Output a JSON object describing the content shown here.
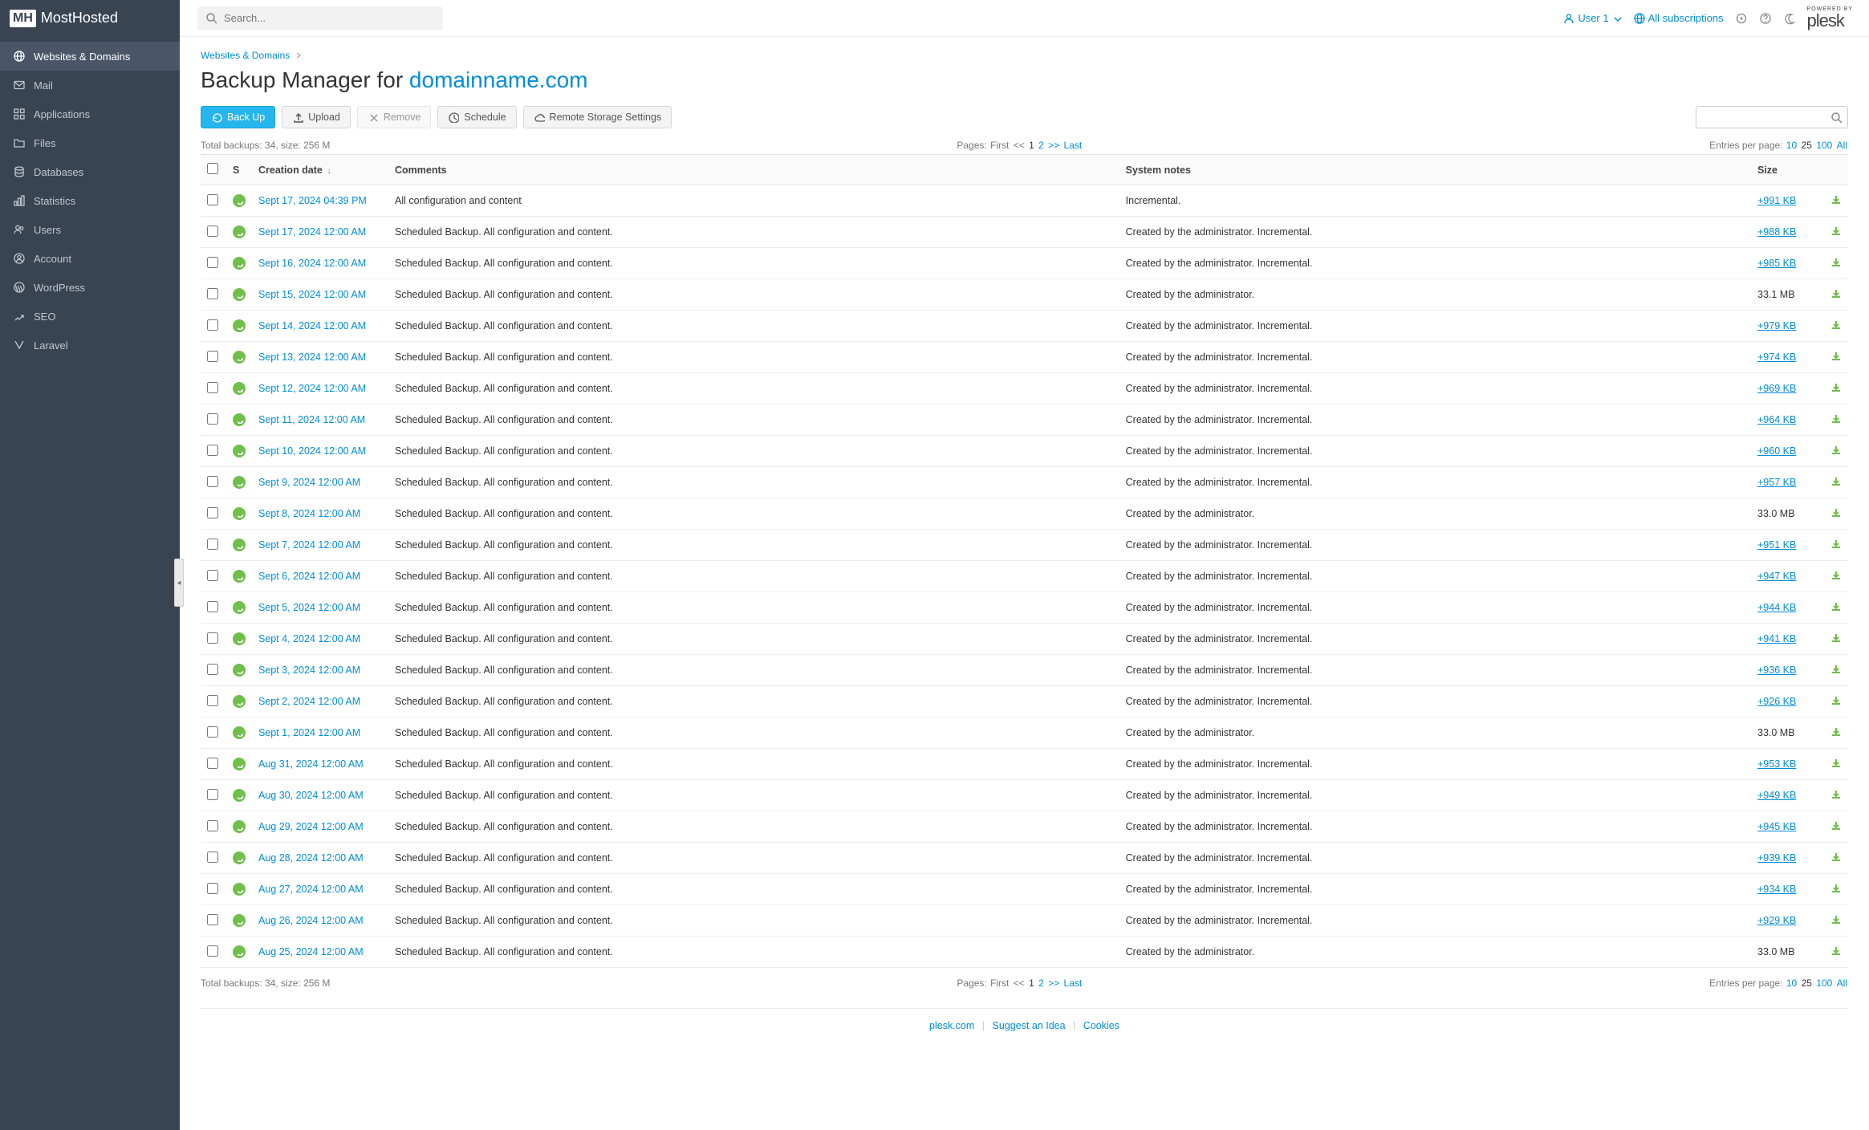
{
  "brand": {
    "badge": "MH",
    "name": "MostHosted"
  },
  "search": {
    "placeholder": "Search..."
  },
  "topbar": {
    "user_label": "User 1",
    "subs_label": "All subscriptions",
    "powered": "POWERED BY",
    "plesk": "plesk"
  },
  "sidebar": {
    "items": [
      {
        "label": "Websites & Domains",
        "icon": "globe",
        "active": true
      },
      {
        "label": "Mail",
        "icon": "mail"
      },
      {
        "label": "Applications",
        "icon": "grid"
      },
      {
        "label": "Files",
        "icon": "folder"
      },
      {
        "label": "Databases",
        "icon": "database"
      },
      {
        "label": "Statistics",
        "icon": "stats"
      },
      {
        "label": "Users",
        "icon": "users"
      },
      {
        "label": "Account",
        "icon": "account"
      },
      {
        "label": "WordPress",
        "icon": "wordpress"
      },
      {
        "label": "SEO",
        "icon": "seo"
      },
      {
        "label": "Laravel",
        "icon": "laravel"
      }
    ]
  },
  "breadcrumb": {
    "item": "Websites & Domains"
  },
  "page_title": {
    "prefix": "Backup Manager for ",
    "domain": "domainname.com"
  },
  "toolbar": {
    "backup": "Back Up",
    "upload": "Upload",
    "remove": "Remove",
    "schedule": "Schedule",
    "remote": "Remote Storage Settings"
  },
  "summary": {
    "total_backups_label": "Total backups: 34, size: 256 M"
  },
  "pagination": {
    "pages_label": "Pages:",
    "first": "First",
    "prev": "<<",
    "p1": "1",
    "p2": "2",
    "next": ">>",
    "last": "Last"
  },
  "entries_per_page": {
    "label": "Entries per page:",
    "o10": "10",
    "o25": "25",
    "o100": "100",
    "oall": "All"
  },
  "columns": {
    "status": "S",
    "creation": "Creation date",
    "sort": "↓",
    "comments": "Comments",
    "notes": "System notes",
    "size": "Size"
  },
  "rows": [
    {
      "date": "Sept 17, 2024 04:39 PM",
      "comments": "All configuration and content",
      "notes": "Incremental.",
      "size": "+991 KB",
      "size_link": true
    },
    {
      "date": "Sept 17, 2024 12:00 AM",
      "comments": "Scheduled Backup. All configuration and content.",
      "notes": "Created by the administrator. Incremental.",
      "size": "+988 KB",
      "size_link": true
    },
    {
      "date": "Sept 16, 2024 12:00 AM",
      "comments": "Scheduled Backup. All configuration and content.",
      "notes": "Created by the administrator. Incremental.",
      "size": "+985 KB",
      "size_link": true
    },
    {
      "date": "Sept 15, 2024 12:00 AM",
      "comments": "Scheduled Backup. All configuration and content.",
      "notes": "Created by the administrator.",
      "size": "33.1 MB",
      "size_link": false
    },
    {
      "date": "Sept 14, 2024 12:00 AM",
      "comments": "Scheduled Backup. All configuration and content.",
      "notes": "Created by the administrator. Incremental.",
      "size": "+979 KB",
      "size_link": true
    },
    {
      "date": "Sept 13, 2024 12:00 AM",
      "comments": "Scheduled Backup. All configuration and content.",
      "notes": "Created by the administrator. Incremental.",
      "size": "+974 KB",
      "size_link": true
    },
    {
      "date": "Sept 12, 2024 12:00 AM",
      "comments": "Scheduled Backup. All configuration and content.",
      "notes": "Created by the administrator. Incremental.",
      "size": "+969 KB",
      "size_link": true
    },
    {
      "date": "Sept 11, 2024 12:00 AM",
      "comments": "Scheduled Backup. All configuration and content.",
      "notes": "Created by the administrator. Incremental.",
      "size": "+964 KB",
      "size_link": true
    },
    {
      "date": "Sept 10, 2024 12:00 AM",
      "comments": "Scheduled Backup. All configuration and content.",
      "notes": "Created by the administrator. Incremental.",
      "size": "+960 KB",
      "size_link": true
    },
    {
      "date": "Sept 9, 2024 12:00 AM",
      "comments": "Scheduled Backup. All configuration and content.",
      "notes": "Created by the administrator. Incremental.",
      "size": "+957 KB",
      "size_link": true
    },
    {
      "date": "Sept 8, 2024 12:00 AM",
      "comments": "Scheduled Backup. All configuration and content.",
      "notes": "Created by the administrator.",
      "size": "33.0 MB",
      "size_link": false
    },
    {
      "date": "Sept 7, 2024 12:00 AM",
      "comments": "Scheduled Backup. All configuration and content.",
      "notes": "Created by the administrator. Incremental.",
      "size": "+951 KB",
      "size_link": true
    },
    {
      "date": "Sept 6, 2024 12:00 AM",
      "comments": "Scheduled Backup. All configuration and content.",
      "notes": "Created by the administrator. Incremental.",
      "size": "+947 KB",
      "size_link": true
    },
    {
      "date": "Sept 5, 2024 12:00 AM",
      "comments": "Scheduled Backup. All configuration and content.",
      "notes": "Created by the administrator. Incremental.",
      "size": "+944 KB",
      "size_link": true
    },
    {
      "date": "Sept 4, 2024 12:00 AM",
      "comments": "Scheduled Backup. All configuration and content.",
      "notes": "Created by the administrator. Incremental.",
      "size": "+941 KB",
      "size_link": true
    },
    {
      "date": "Sept 3, 2024 12:00 AM",
      "comments": "Scheduled Backup. All configuration and content.",
      "notes": "Created by the administrator. Incremental.",
      "size": "+936 KB",
      "size_link": true
    },
    {
      "date": "Sept 2, 2024 12:00 AM",
      "comments": "Scheduled Backup. All configuration and content.",
      "notes": "Created by the administrator. Incremental.",
      "size": "+926 KB",
      "size_link": true
    },
    {
      "date": "Sept 1, 2024 12:00 AM",
      "comments": "Scheduled Backup. All configuration and content.",
      "notes": "Created by the administrator.",
      "size": "33.0 MB",
      "size_link": false
    },
    {
      "date": "Aug 31, 2024 12:00 AM",
      "comments": "Scheduled Backup. All configuration and content.",
      "notes": "Created by the administrator. Incremental.",
      "size": "+953 KB",
      "size_link": true
    },
    {
      "date": "Aug 30, 2024 12:00 AM",
      "comments": "Scheduled Backup. All configuration and content.",
      "notes": "Created by the administrator. Incremental.",
      "size": "+949 KB",
      "size_link": true
    },
    {
      "date": "Aug 29, 2024 12:00 AM",
      "comments": "Scheduled Backup. All configuration and content.",
      "notes": "Created by the administrator. Incremental.",
      "size": "+945 KB",
      "size_link": true
    },
    {
      "date": "Aug 28, 2024 12:00 AM",
      "comments": "Scheduled Backup. All configuration and content.",
      "notes": "Created by the administrator. Incremental.",
      "size": "+939 KB",
      "size_link": true
    },
    {
      "date": "Aug 27, 2024 12:00 AM",
      "comments": "Scheduled Backup. All configuration and content.",
      "notes": "Created by the administrator. Incremental.",
      "size": "+934 KB",
      "size_link": true
    },
    {
      "date": "Aug 26, 2024 12:00 AM",
      "comments": "Scheduled Backup. All configuration and content.",
      "notes": "Created by the administrator. Incremental.",
      "size": "+929 KB",
      "size_link": true
    },
    {
      "date": "Aug 25, 2024 12:00 AM",
      "comments": "Scheduled Backup. All configuration and content.",
      "notes": "Created by the administrator.",
      "size": "33.0 MB",
      "size_link": false
    }
  ],
  "footer": {
    "plesk": "plesk.com",
    "suggest": "Suggest an Idea",
    "cookies": "Cookies"
  }
}
